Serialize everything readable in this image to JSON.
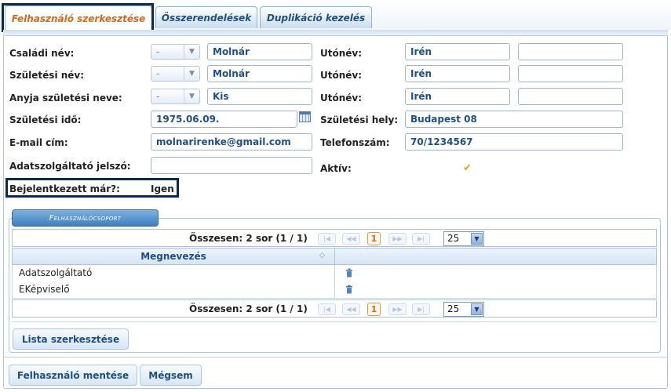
{
  "tabs": [
    {
      "label": "Felhasználó szerkesztése",
      "active": true
    },
    {
      "label": "Összerendelések",
      "active": false
    },
    {
      "label": "Duplikáció kezelés",
      "active": false
    }
  ],
  "form": {
    "family_name": {
      "label": "Családi név:",
      "prefix": "-",
      "value": "Molnár",
      "given_label": "Utónév:",
      "given": "Irén",
      "given2": ""
    },
    "birth_name": {
      "label": "Születési név:",
      "prefix": "-",
      "value": "Molnár",
      "given_label": "Utónév:",
      "given": "Irén",
      "given2": ""
    },
    "mother_name": {
      "label": "Anyja születési neve:",
      "prefix": "-",
      "value": "Kis",
      "given_label": "Utónév:",
      "given": "Irén",
      "given2": ""
    },
    "birth_date": {
      "label": "Születési idő:",
      "value": "1975.06.09."
    },
    "birth_place": {
      "label": "Születési hely:",
      "value": "Budapest 08"
    },
    "email": {
      "label": "E-mail cím:",
      "value": "molnarirenke@gmail.com"
    },
    "phone": {
      "label": "Telefonszám:",
      "value": "70/1234567"
    },
    "provider_password": {
      "label": "Adatszolgáltató jelszó:",
      "value": ""
    },
    "active": {
      "label": "Aktív:",
      "checked": true
    },
    "logged_in": {
      "label": "Bejelentkezett már?:",
      "value": "Igen"
    }
  },
  "group": {
    "title": "Felhasználócsoport",
    "pager_text": "Összesen: 2 sor (1 / 1)",
    "current_page": "1",
    "page_size": "25",
    "column_header": "Megnevezés",
    "rows": [
      "Adatszolgáltató",
      "EKépviselő"
    ],
    "edit_list_button": "Lista szerkesztése"
  },
  "footer": {
    "save_button": "Felhasználó mentése",
    "cancel_button": "Mégsem"
  },
  "colors": {
    "accent": "#1e4f86",
    "active_tab_text": "#d2691e",
    "highlight_outline": "#0b2a4f",
    "checkbox": "#e6a500"
  }
}
